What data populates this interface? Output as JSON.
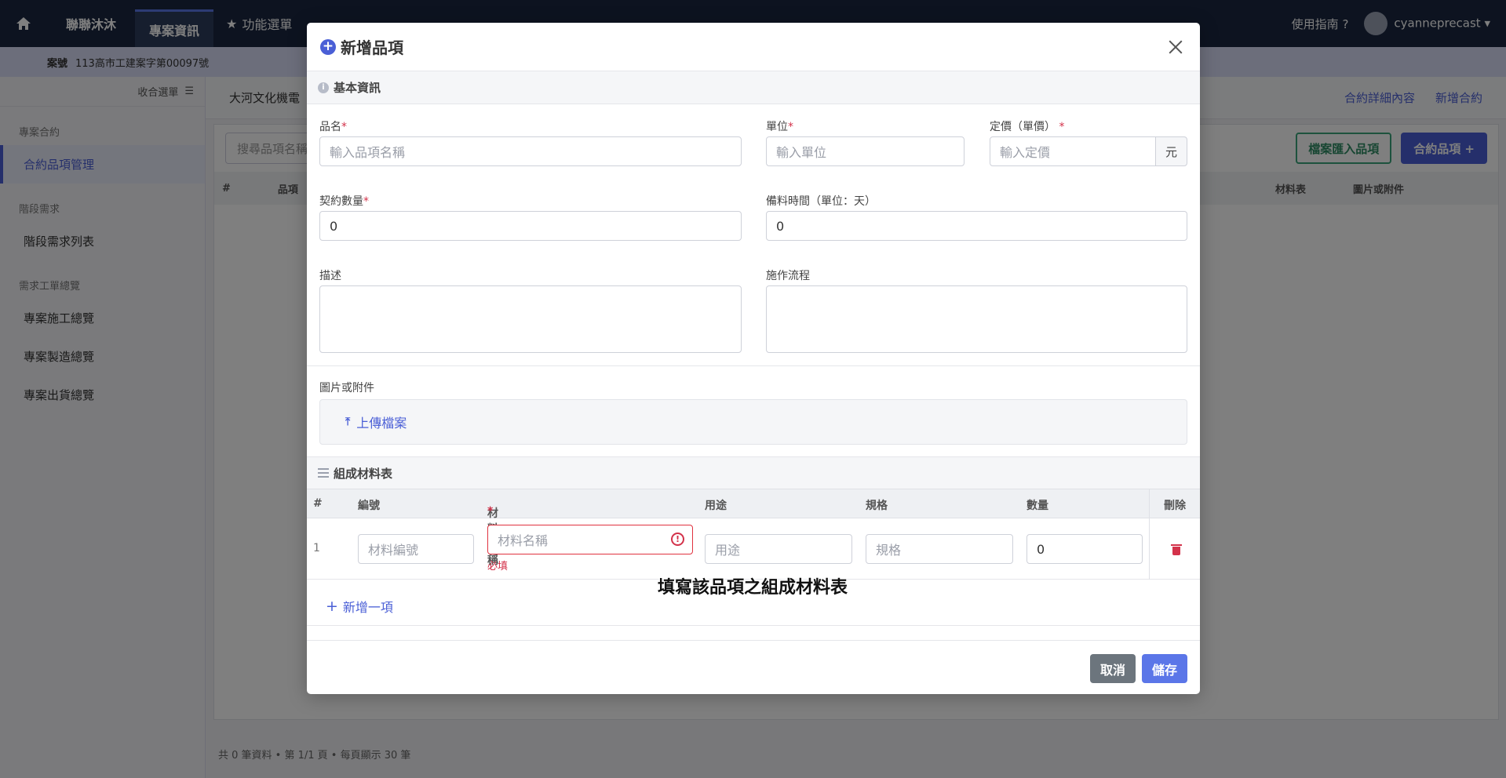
{
  "topbar": {
    "brand": "聯聯沐沐",
    "active_tab": "專案資訊",
    "function_menu": "功能選單",
    "guide": "使用指南",
    "username": "cyanneprecast"
  },
  "subbar": {
    "case_label": "案號",
    "case_number": "113高市工建案字第00097號"
  },
  "sidebar": {
    "header_label": "收合選單",
    "groups": [
      {
        "title": "專案合約",
        "items": [
          "合約品項管理"
        ]
      },
      {
        "title": "階段需求",
        "items": [
          "階段需求列表"
        ]
      },
      {
        "title": "需求工單總覽",
        "items": [
          "專案施工總覽",
          "專案製造總覽",
          "專案出貨總覽"
        ]
      }
    ]
  },
  "main": {
    "project_title": "大河文化機電",
    "contract_detail": "合約詳細內容",
    "new_contract": "新增合約",
    "search_placeholder": "搜尋品項名稱",
    "import_button": "檔案匯入品項",
    "contract_items_button": "合約品項 +",
    "table_headers": [
      "#",
      "品項",
      "材料表",
      "圖片或附件"
    ],
    "footer": "共 0 筆資料 • 第 1/1 頁 • 每頁顯示 30 筆"
  },
  "modal": {
    "title": "新增品項",
    "basic_section": "基本資訊",
    "fields": {
      "name_label": "品名",
      "name_placeholder": "輸入品項名稱",
      "unit_label": "單位",
      "unit_placeholder": "輸入單位",
      "price_label": "定價（單價）",
      "price_placeholder": "輸入定價",
      "price_addon": "元",
      "qty_label": "契約數量",
      "qty_value": "0",
      "prep_label": "備料時間（單位：天）",
      "prep_value": "0",
      "desc_label": "描述",
      "process_label": "施作流程",
      "attach_label": "圖片或附件",
      "upload_button": "上傳檔案"
    },
    "materials_section": "組成材料表",
    "material_headers": {
      "index": "#",
      "code": "編號",
      "name": "材料名稱",
      "usage": "用途",
      "spec": "規格",
      "qty": "數量",
      "delete": "刪除"
    },
    "material_rows": [
      {
        "index": "1",
        "code_placeholder": "材料編號",
        "name_placeholder": "材料名稱",
        "usage_placeholder": "用途",
        "spec_placeholder": "規格",
        "qty_value": "0",
        "error": "必填"
      }
    ],
    "add_row": "新增一項",
    "cancel": "取消",
    "save": "儲存",
    "required_mark": "*"
  },
  "caption": "填寫該品項之組成材料表",
  "colors": {
    "primary": "#4a5fd6",
    "danger": "#d3324a",
    "secondary": "#6c757d",
    "navbar": "#1a2740"
  }
}
